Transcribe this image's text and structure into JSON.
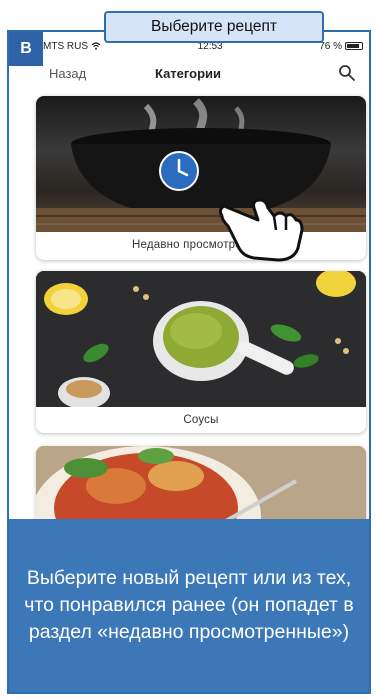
{
  "tooltip": {
    "text": "Выберите рецепт"
  },
  "step_badge": {
    "letter": "B"
  },
  "status_bar": {
    "carrier": "MTS RUS",
    "time": "12:53",
    "battery": "76 %"
  },
  "nav": {
    "back_label": "Назад",
    "title": "Категории",
    "search_icon": "search-icon"
  },
  "categories": [
    {
      "label": "Недавно просмотренные",
      "icon": "clock-icon"
    },
    {
      "label": "Соусы"
    },
    {
      "label": ""
    }
  ],
  "info": {
    "text": "Выберите новый рецепт или из тех, что понравился ранее (он попадет в раздел «недавно просмотренные»)"
  },
  "colors": {
    "accent": "#2f6db0",
    "badge": "#2e63a8",
    "info_bg": "#3c78b8",
    "tooltip_bg": "#d6e4f7"
  }
}
